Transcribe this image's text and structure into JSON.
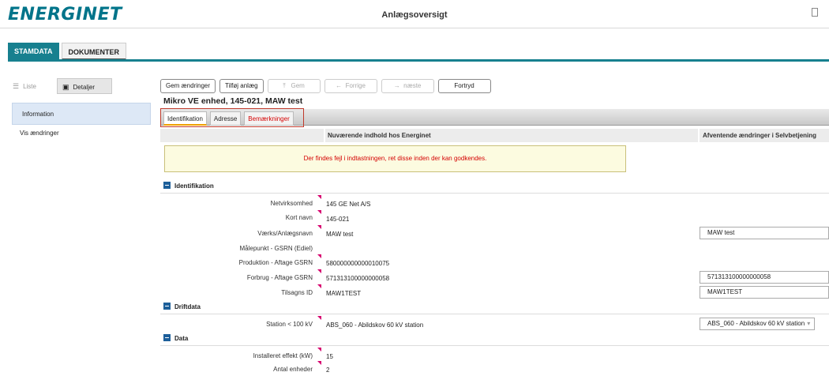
{
  "header": {
    "logo_left": "ENERGI",
    "logo_right": "NET",
    "title": "Anlægsoversigt",
    "doc_icon": "document-icon"
  },
  "main_tabs": [
    {
      "label": "STAMDATA",
      "active": true
    },
    {
      "label": "DOKUMENTER",
      "active": false
    }
  ],
  "view_toggle": {
    "liste": {
      "label": "Liste",
      "icon": "list-icon"
    },
    "detaljer": {
      "label": "Detaljer",
      "icon": "details-icon"
    }
  },
  "sidenav": [
    {
      "label": "Information",
      "active": true
    },
    {
      "label": "Vis ændringer",
      "active": false
    }
  ],
  "toolbar": {
    "save_changes": "Gem ændringer",
    "add_plant": "Tilføj anlæg",
    "save": "Gem",
    "previous": "Forrige",
    "next": "næste",
    "undo": "Fortryd"
  },
  "record_title": "Mikro VE enhed, 145-021, MAW test",
  "subtabs": [
    {
      "label": "Identifikation",
      "active": true
    },
    {
      "label": "Adresse",
      "active": false
    },
    {
      "label": "Bemærkninger",
      "active": false
    }
  ],
  "columns": {
    "current": "Nuværende indhold hos Energinet",
    "pending": "Afventende ændringer i Selvbetjening"
  },
  "error_message": "Der findes fejl i indtastningen, ret disse inden der kan godkendes.",
  "sections": {
    "identifikation": {
      "title": "Identifikation",
      "fields": [
        {
          "label": "Netvirksomhed",
          "value": "145 GE Net A/S",
          "pending": ""
        },
        {
          "label": "Kort navn",
          "value": "145-021",
          "pending": ""
        },
        {
          "label": "Værks/Anlægsnavn",
          "value": "MAW test",
          "pending": "MAW test"
        },
        {
          "label": "Målepunkt - GSRN (Ediel)",
          "value": "",
          "pending": ""
        },
        {
          "label": "Produktion - Aftage GSRN",
          "value": "580000000000010075",
          "pending": ""
        },
        {
          "label": "Forbrug - Aftage GSRN",
          "value": "571313100000000058",
          "pending": "571313100000000058"
        },
        {
          "label": "Tilsagns ID",
          "value": "MAW1TEST",
          "pending": "MAW1TEST"
        }
      ]
    },
    "driftdata": {
      "title": "Driftdata",
      "fields": [
        {
          "label": "Station < 100 kV",
          "value": "ABS_060 - Abildskov 60 kV station",
          "pending": "ABS_060 - Abildskov 60 kV station"
        }
      ]
    },
    "data": {
      "title": "Data",
      "fields": [
        {
          "label": "Installeret effekt (kW)",
          "value": "15",
          "pending": ""
        },
        {
          "label": "Antal enheder",
          "value": "2",
          "pending": ""
        }
      ]
    }
  },
  "colors": {
    "accent": "#17808f",
    "error": "#d40000",
    "marker": "#d6006e",
    "section_icon": "#1d5f9a"
  }
}
